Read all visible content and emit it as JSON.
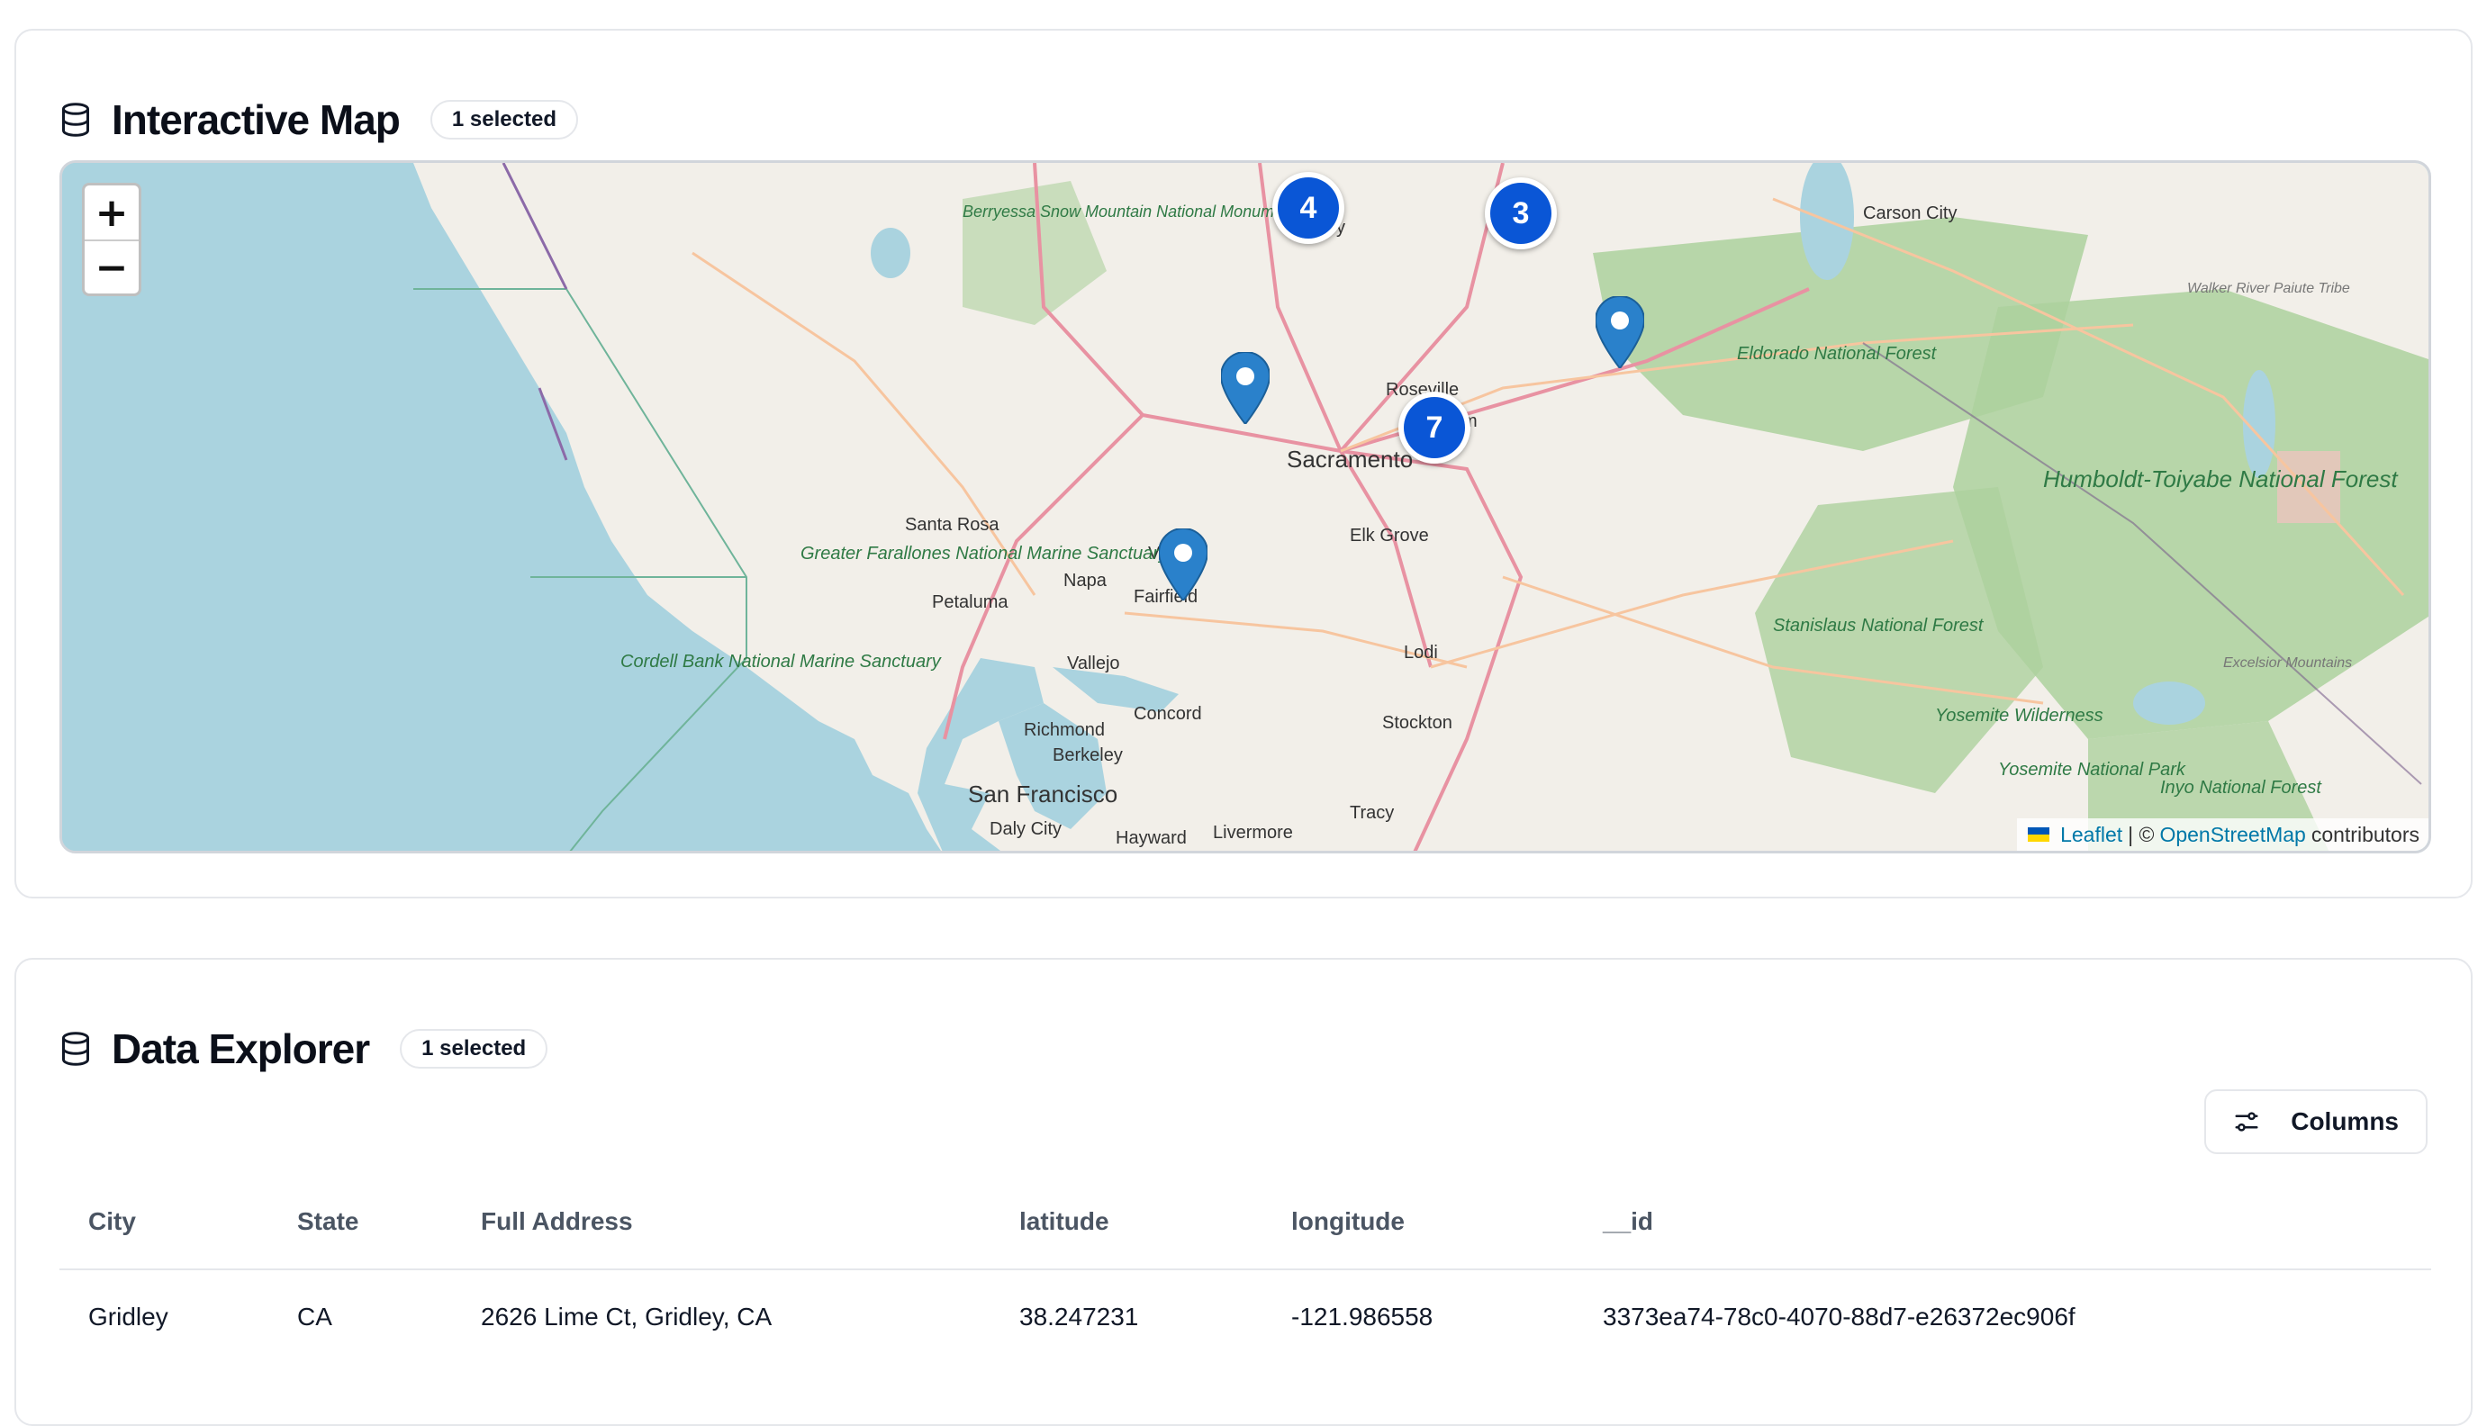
{
  "map_card": {
    "title": "Interactive Map",
    "badge": "1 selected",
    "zoom_in": "+",
    "zoom_out": "−",
    "clusters": [
      {
        "label": "4"
      },
      {
        "label": "3"
      },
      {
        "label": "7"
      }
    ],
    "place_labels": {
      "sacramento": "Sacramento",
      "roseville": "Roseville",
      "elk_grove": "Elk Grove",
      "santa_rosa": "Santa Rosa",
      "napa": "Napa",
      "petaluma": "Petaluma",
      "fairfield": "Fairfield",
      "vacaville": "Va",
      "vallejo": "Vallejo",
      "concord": "Concord",
      "richmond": "Richmond",
      "berkeley": "Berkeley",
      "san_francisco": "San Francisco",
      "daly_city": "Daly City",
      "hayward": "Hayward",
      "livermore": "Livermore",
      "tracy": "Tracy",
      "stockton": "Stockton",
      "lodi": "Lodi",
      "carson_city": "Carson City",
      "folsom": "m",
      "yuba": "y",
      "berryessa": "Berryessa Snow Mountain National Monument",
      "greater_farallones": "Greater Farallones National Marine Sanctuary",
      "cordell_bank": "Cordell Bank National Marine Sanctuary",
      "eldorado": "Eldorado National Forest",
      "stanislaus": "Stanislaus National Forest",
      "humboldt": "Humboldt-Toiyabe National Forest",
      "yosemite_wilderness": "Yosemite Wilderness",
      "yosemite_park": "Yosemite National Park",
      "inyo": "Inyo National Forest",
      "walker": "Walker River Paiute Tribe",
      "excelsior": "Excelsior Mountains"
    },
    "attribution": {
      "leaflet": "Leaflet",
      "separator": "| ©",
      "osm": "OpenStreetMap",
      "suffix": "contributors"
    }
  },
  "table_card": {
    "title": "Data Explorer",
    "badge": "1 selected",
    "columns_button": "Columns",
    "headers": [
      "City",
      "State",
      "Full Address",
      "latitude",
      "longitude",
      "__id"
    ],
    "rows": [
      [
        "Gridley",
        "CA",
        "2626 Lime Ct, Gridley, CA",
        "38.247231",
        "-121.986558",
        "3373ea74-78c0-4070-88d7-e26372ec906f"
      ]
    ]
  },
  "colors": {
    "cluster": "#0a56d6",
    "pin": "#2a81cb",
    "water": "#aad3df",
    "land": "#f2efe9",
    "forest": "#add19e"
  }
}
